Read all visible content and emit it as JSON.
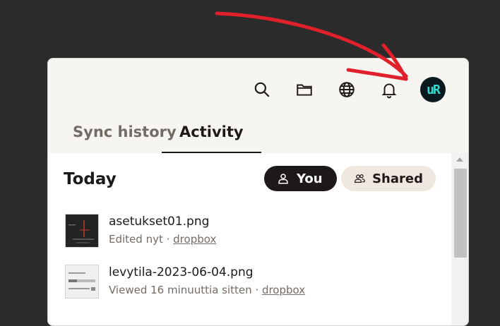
{
  "tabs": {
    "sync_history": "Sync history",
    "activity": "Activity"
  },
  "toolbar": {
    "icons": [
      "search-icon",
      "folder-icon",
      "globe-icon",
      "bell-icon"
    ],
    "avatar_initials": "uR"
  },
  "section": {
    "title": "Today"
  },
  "filters": {
    "you": "You",
    "shared": "Shared"
  },
  "files": [
    {
      "name": "asetukset01.png",
      "action": "Edited nyt",
      "separator": " · ",
      "location": "dropbox"
    },
    {
      "name": "levytila-2023-06-04.png",
      "action": "Viewed 16 minuuttia sitten",
      "separator": " · ",
      "location": "dropbox"
    }
  ],
  "colors": {
    "background": "#2b2b2b",
    "panel": "#f7f5f2",
    "accent_dark": "#1e1919",
    "annotation_arrow": "#e0202a",
    "avatar_text": "#38d9d0"
  }
}
